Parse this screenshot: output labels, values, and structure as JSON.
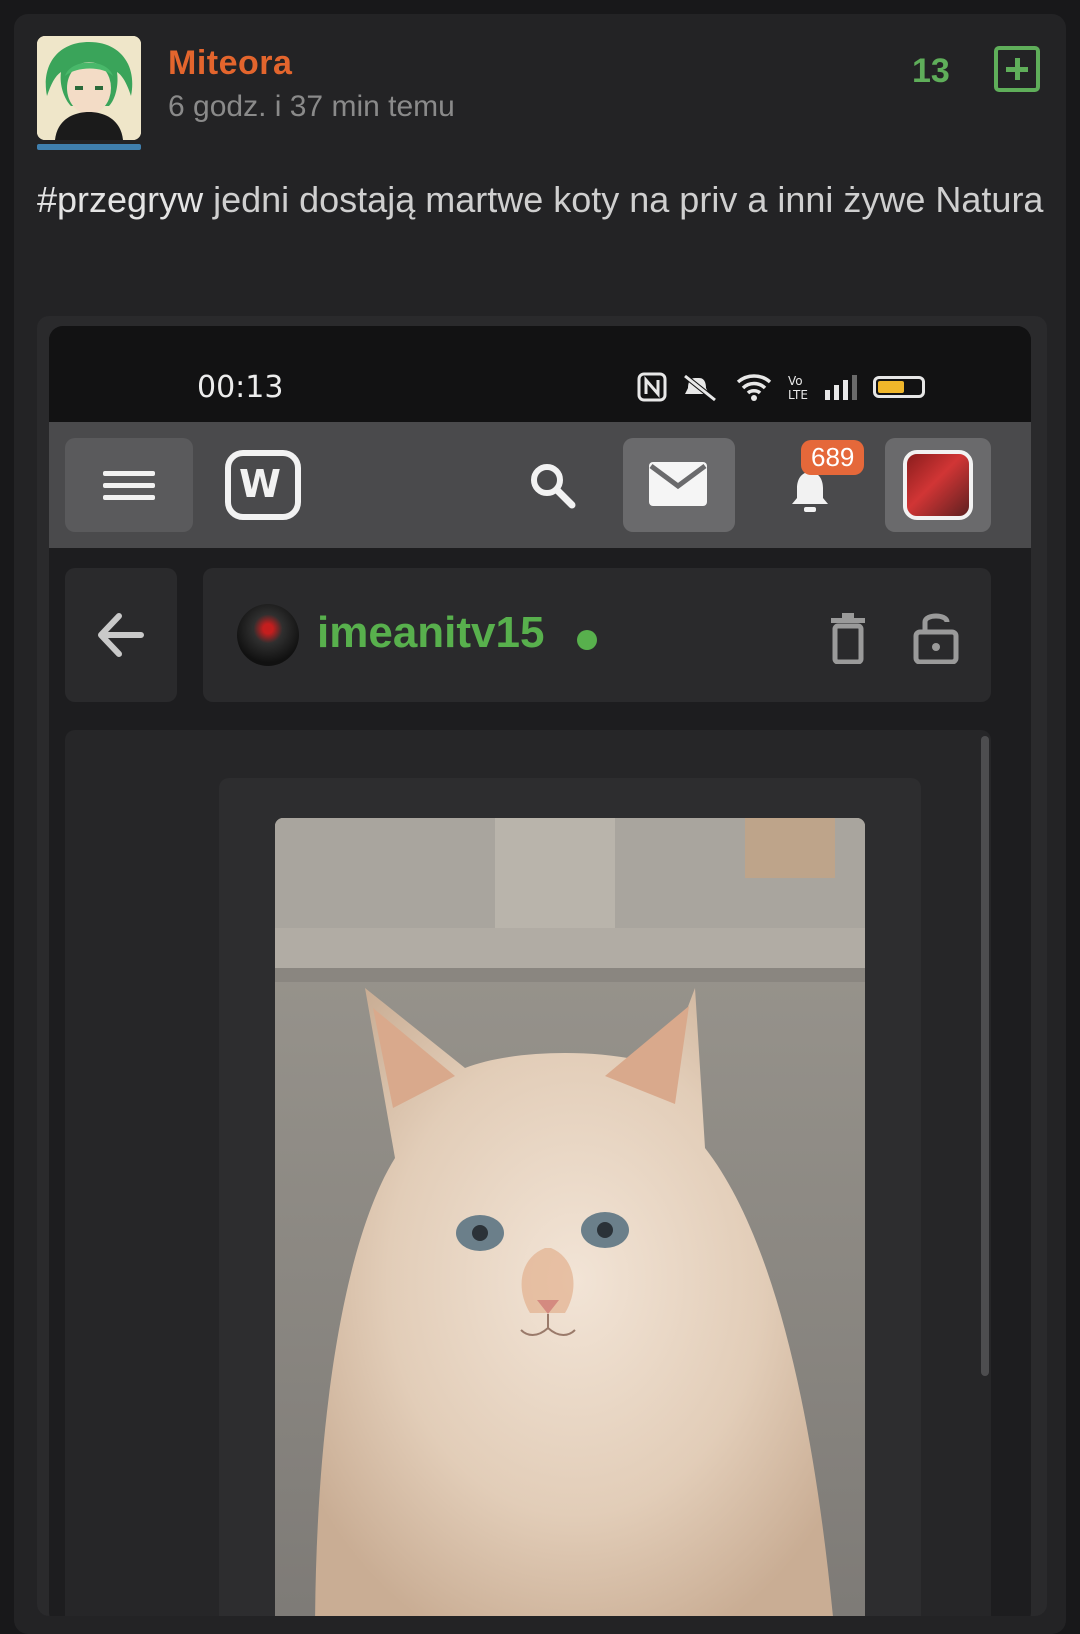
{
  "post": {
    "author": "Miteora",
    "time": "6 godz. i 37 min temu",
    "votes": "13",
    "hashtag": "#przegryw",
    "text": " jedni dostają martwe koty na priv a inni żywe Natura"
  },
  "screenshot": {
    "status_time": "00:13",
    "notification_count": "689",
    "logo_text": "W",
    "chat_user": "imeanitv15"
  },
  "colors": {
    "author": "#e3652d",
    "votes": "#5fae5a",
    "chat_user": "#58b04d",
    "badge": "#e5683a",
    "battery": "#f0b62a"
  }
}
